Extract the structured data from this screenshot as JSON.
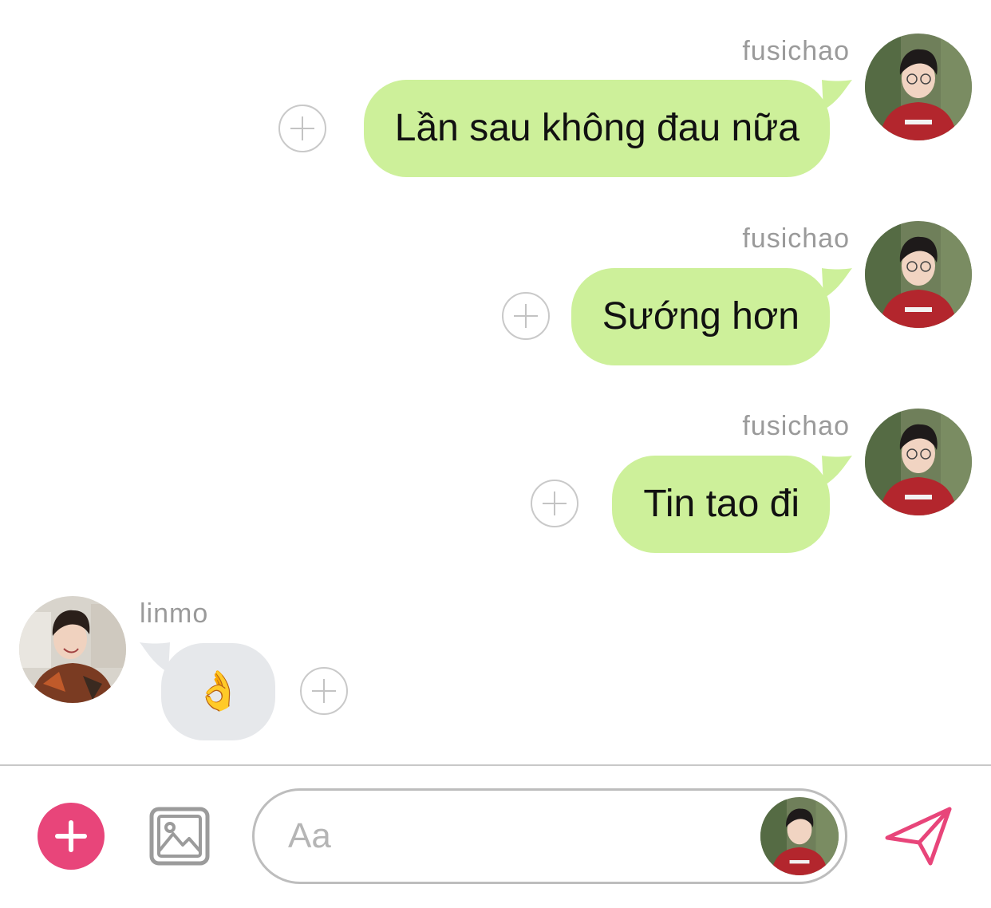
{
  "colors": {
    "outgoing_bubble": "#cdf09a",
    "incoming_bubble": "#e6e8eb",
    "accent": "#e8457a",
    "name_text": "#9a9a9a"
  },
  "messages": [
    {
      "sender": "fusichao",
      "direction": "outgoing",
      "text": "Lần sau không đau nữa"
    },
    {
      "sender": "fusichao",
      "direction": "outgoing",
      "text": "Sướng hơn"
    },
    {
      "sender": "fusichao",
      "direction": "outgoing",
      "text": "Tin tao đi"
    },
    {
      "sender": "linmo",
      "direction": "incoming",
      "text": "👌"
    }
  ],
  "composer": {
    "add_icon": "plus-icon",
    "image_icon": "image-icon",
    "placeholder": "Aa",
    "send_icon": "send-icon"
  }
}
